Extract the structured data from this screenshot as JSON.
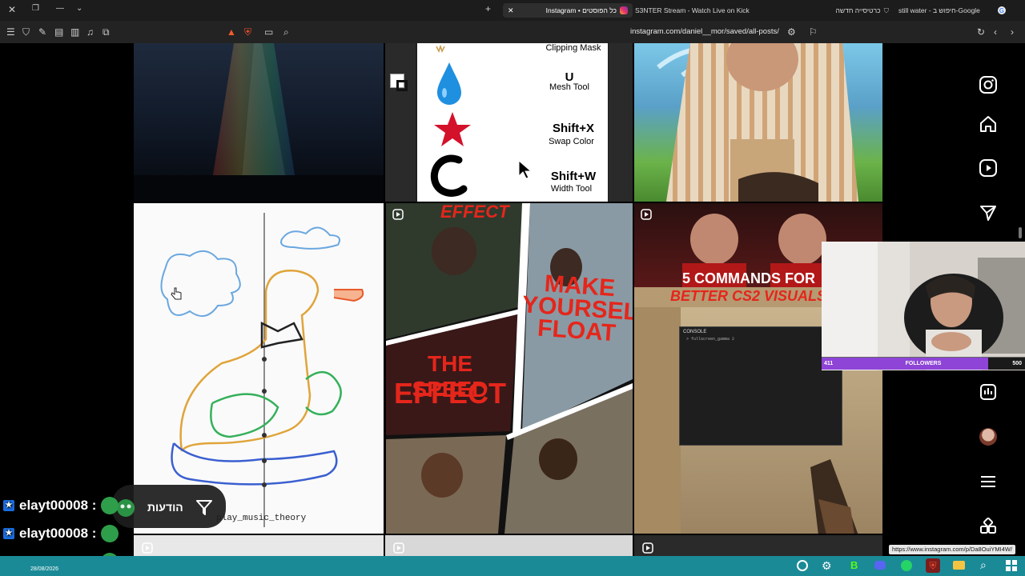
{
  "browser": {
    "tabs": [
      {
        "title": "still water - חיפוש ב-Google"
      },
      {
        "title": "כרטיסייה חדשה"
      },
      {
        "title": "S3NTER Stream - Watch Live on Kick"
      },
      {
        "title": "Instagram • כל הפוסטים",
        "active": true
      }
    ],
    "url": "instagram.com/daniel__mor/saved/all-posts/"
  },
  "shortcuts": [
    {
      "key": "",
      "name": "Clipping Mask"
    },
    {
      "key": "U",
      "name": "Mesh Tool"
    },
    {
      "key": "Shift+X",
      "name": "Swap Color"
    },
    {
      "key": "Shift+W",
      "name": "Width Tool"
    }
  ],
  "tiles": {
    "music_caption": "play_music_theory",
    "vfx_top": "EFFECT",
    "vfx_right": "MAKE YOURSELF FLOAT",
    "vfx_left_1": "THE SPEED",
    "vfx_left_2": "EFFECT",
    "cs2_line1": "5 COMMANDS FOR",
    "cs2_line2": "BETTER CS2 VISUALS",
    "console_title": "CONSOLE",
    "console_line": "> fullscreen_gamma 2"
  },
  "overlay": {
    "followers_min": "411",
    "followers_label": "FOLLOWERS",
    "followers_max": "500",
    "followers_progress": 0.82
  },
  "chat": {
    "user": "elayt00008 :",
    "notif_label": "הודעות",
    "date": "28/08/2026"
  },
  "status_url": "https://www.instagram.com/p/Da8OuiYMI4W/",
  "colors": {
    "accent_purple": "#8e44d6",
    "taskbar": "#1b8a97",
    "kick_green": "#53fc18",
    "yt_red": "#e5261b"
  }
}
